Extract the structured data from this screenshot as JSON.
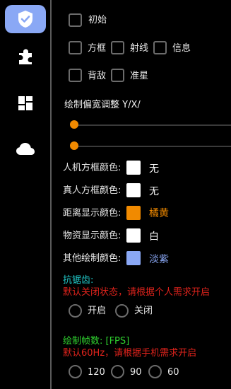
{
  "sidebar": {
    "items": [
      {
        "icon": "shield-check-icon",
        "active": true
      },
      {
        "icon": "puzzle-icon",
        "active": false
      },
      {
        "icon": "dashboard-icon",
        "active": false
      },
      {
        "icon": "cloud-icon",
        "active": false
      }
    ]
  },
  "toggles": {
    "initial": "初始",
    "box": "方框",
    "ray": "射线",
    "info": "信息",
    "back_enemy": "背敌",
    "crosshair": "准星"
  },
  "offset": {
    "title": "绘制偏宽调整 Y/X/"
  },
  "colors": {
    "bot_box": {
      "label": "人机方框颜色:",
      "value": "无",
      "hex": "#ffffff"
    },
    "real_box": {
      "label": "真人方框颜色:",
      "value": "无",
      "hex": "#ffffff"
    },
    "distance": {
      "label": "距离显示颜色:",
      "value": "橘黄",
      "hex": "#f18a00"
    },
    "supplies": {
      "label": "物资显示颜色:",
      "value": "白",
      "hex": "#ffffff"
    },
    "other": {
      "label": "其他绘制颜色:",
      "value": "淡紫",
      "hex": "#8aa8f5"
    }
  },
  "antialias": {
    "title": "抗锯齿:",
    "note": "默认关闭状态，请根据个人需求开启",
    "on": "开启",
    "off": "关闭"
  },
  "fps": {
    "title": "绘制帧数: [FPS]",
    "note": "默认60Hz，请根据手机需求开启",
    "options": [
      "120",
      "90",
      "60"
    ]
  },
  "theme": {
    "accent": "#8aa8f5",
    "orange": "#f18a00",
    "teal": "#21c9c9",
    "green": "#2fd12f",
    "red": "#e0231c"
  }
}
